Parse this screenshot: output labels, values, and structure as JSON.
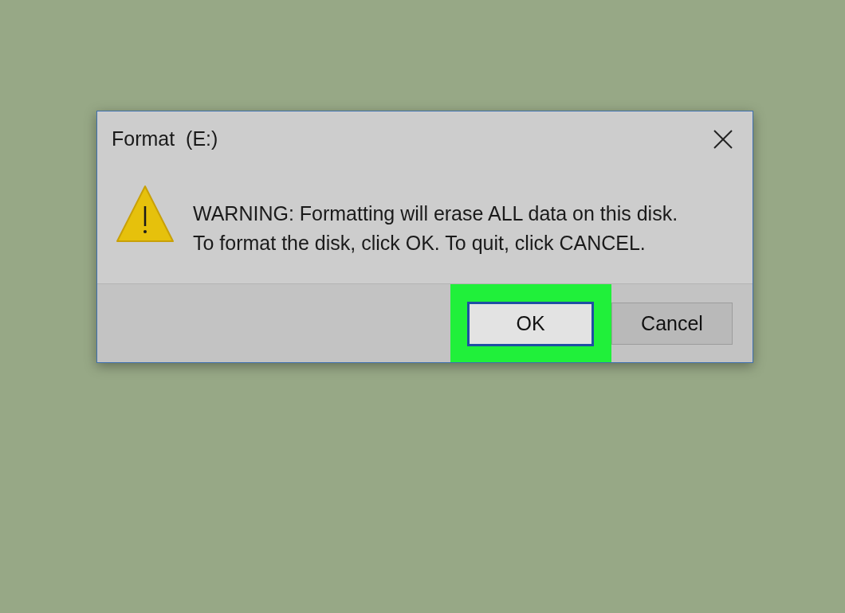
{
  "window": {
    "title": "Format  (E:)"
  },
  "message": {
    "lines": [
      "WARNING: Formatting will erase ALL data on this disk.",
      "To format the disk, click OK. To quit, click CANCEL."
    ]
  },
  "buttons": [
    {
      "label": "OK",
      "focused": true,
      "highlighted": true
    },
    {
      "label": "Cancel",
      "focused": false,
      "highlighted": false
    }
  ]
}
